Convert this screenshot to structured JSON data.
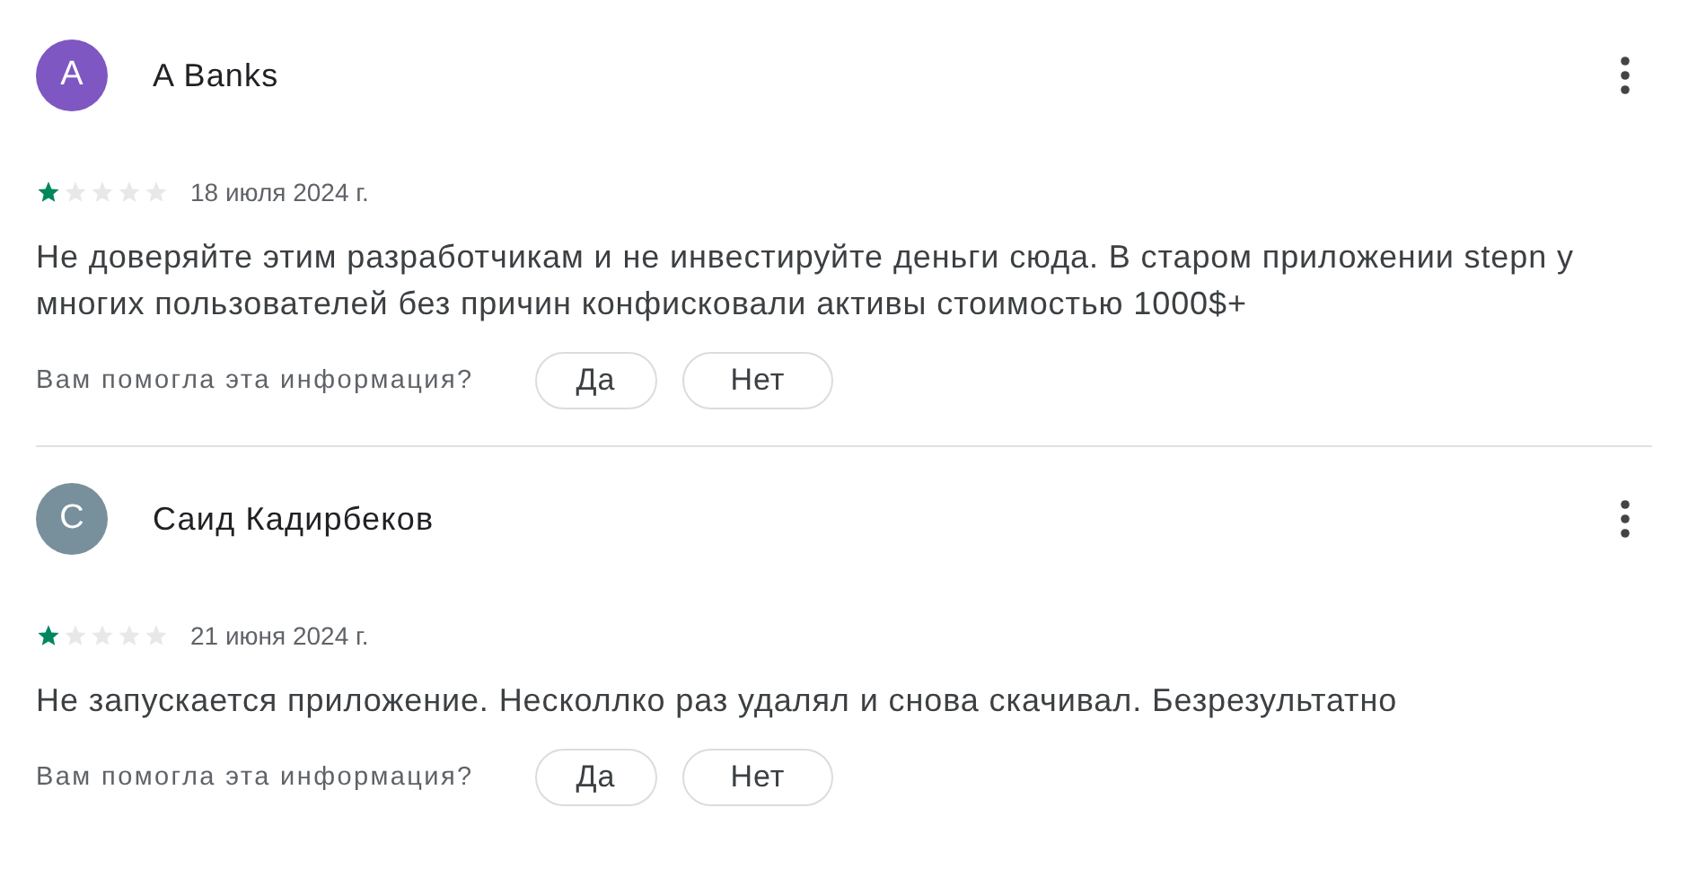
{
  "reviews": [
    {
      "avatar_letter": "A",
      "color": "#7e57c2",
      "author": "A Banks",
      "stars": 1,
      "date": "18 июля 2024 г.",
      "text": "Не доверяйте этим разработчикам и не инвестируйте деньги сюда. В старом приложении stepn у многих пользователей без причин конфисковали активы стоимостью 1000$+",
      "helpful_prompt": "Вам помогла эта информация?",
      "buttons": [
        "Да",
        "Нет"
      ]
    },
    {
      "avatar_letter": "С",
      "color": "#78909c",
      "author": "Саид Кадирбеков",
      "stars": 1,
      "date": "21 июня 2024 г.",
      "text": "Не запускается приложение. Несколлко раз удалял и снова скачивал. Безрезультатно",
      "helpful_prompt": "Вам помогла эта информация?",
      "buttons": [
        "Да",
        "Нет"
      ]
    }
  ]
}
